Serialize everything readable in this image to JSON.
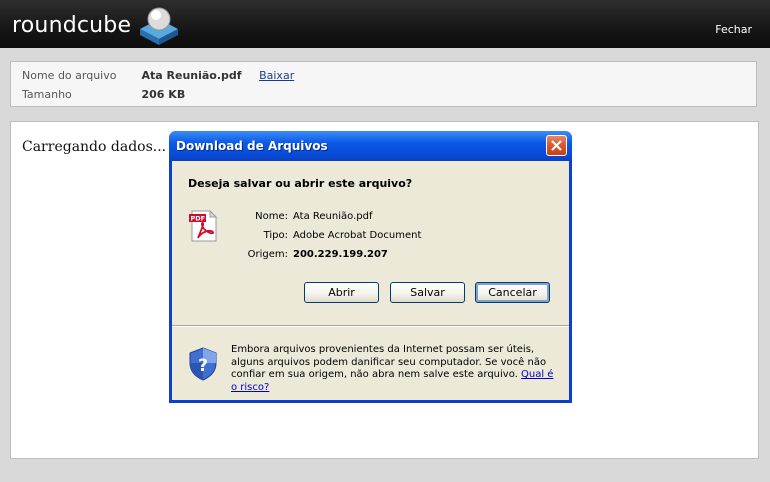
{
  "app": {
    "logo_text": "roundcube",
    "close_label": "Fechar"
  },
  "file_info": {
    "name_label": "Nome do arquivo",
    "name_value": "Ata Reunião.pdf",
    "download_label": "Baixar",
    "size_label": "Tamanho",
    "size_value": "206 KB"
  },
  "content": {
    "loading_text": "Carregando dados..."
  },
  "dialog": {
    "title": "Download de Arquivos",
    "question": "Deseja salvar ou abrir este arquivo?",
    "file_icon": "pdf-icon",
    "fields": {
      "name_label": "Nome:",
      "name_value": "Ata Reunião.pdf",
      "type_label": "Tipo:",
      "type_value": "Adobe Acrobat Document",
      "origin_label": "Origem:",
      "origin_value": "200.229.199.207"
    },
    "buttons": {
      "open": "Abrir",
      "save": "Salvar",
      "cancel": "Cancelar"
    },
    "warning_icon": "shield-question-icon",
    "warning_text": "Embora arquivos provenientes da Internet possam ser úteis, alguns arquivos podem danificar seu computador. Se você não confiar em sua origem, não abra nem salve este arquivo.",
    "risk_link": "Qual é o risco?"
  },
  "colors": {
    "header_bg": "#161616",
    "titlebar_blue": "#0a5ae8",
    "dialog_body": "#ece9d8",
    "close_red": "#d9552d",
    "link_blue": "#1c3e8a"
  }
}
